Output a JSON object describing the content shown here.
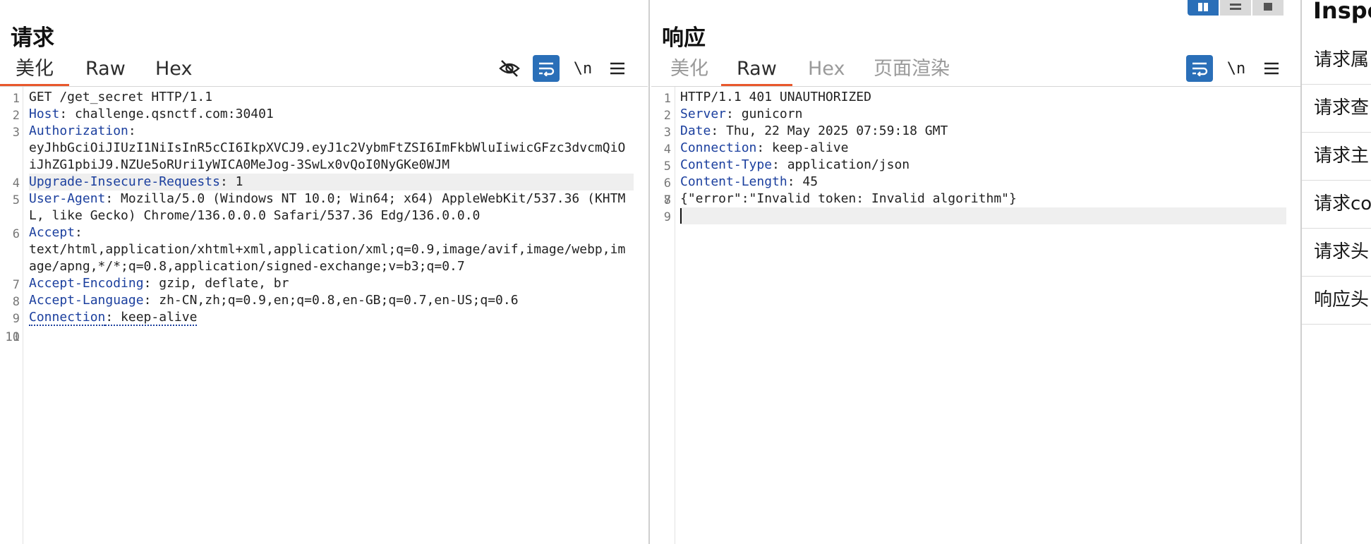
{
  "request": {
    "title": "请求",
    "tabs": [
      "美化",
      "Raw",
      "Hex"
    ],
    "active_tab": 0,
    "toolbar": {
      "newline_label": "\\n"
    },
    "lines": [
      {
        "n": "1",
        "key": "",
        "val": "GET /get_secret HTTP/1.1"
      },
      {
        "n": "2",
        "key": "Host",
        "val": ": challenge.qsnctf.com:30401"
      },
      {
        "n": "3",
        "key": "Authorization",
        "val": ":"
      },
      {
        "n": "",
        "key": "",
        "val": "eyJhbGciOiJIUzI1NiIsInR5cCI6IkpXVCJ9.eyJ1c2VybmFtZSI6ImFkbWluIiwicGFzc3dvcmQiOiJhZG1pbiJ9.NZUe5oRUri1yWICA0MeJog-3SwLx0vQoI0NyGKe0WJM"
      },
      {
        "n": "4",
        "key": "Upgrade-Insecure-Requests",
        "val": ": 1"
      },
      {
        "n": "5",
        "key": "User-Agent",
        "val": ": Mozilla/5.0 (Windows NT 10.0; Win64; x64) AppleWebKit/537.36 (KHTML, like Gecko) Chrome/136.0.0.0 Safari/537.36 Edg/136.0.0.0"
      },
      {
        "n": "6",
        "key": "Accept",
        "val": ":"
      },
      {
        "n": "",
        "key": "",
        "val": "text/html,application/xhtml+xml,application/xml;q=0.9,image/avif,image/webp,image/apng,*/*;q=0.8,application/signed-exchange;v=b3;q=0.7"
      },
      {
        "n": "7",
        "key": "Accept-Encoding",
        "val": ": gzip, deflate, br"
      },
      {
        "n": "8",
        "key": "Accept-Language",
        "val": ": zh-CN,zh;q=0.9,en;q=0.8,en-GB;q=0.7,en-US;q=0.6"
      },
      {
        "n": "9",
        "key": "Connection",
        "val": ": keep-alive"
      },
      {
        "n": "10",
        "key": "",
        "val": ""
      },
      {
        "n": "11",
        "key": "",
        "val": ""
      }
    ]
  },
  "response": {
    "title": "响应",
    "tabs": [
      "美化",
      "Raw",
      "Hex",
      "页面渲染"
    ],
    "active_tab": 1,
    "toolbar": {
      "newline_label": "\\n"
    },
    "lines": [
      {
        "n": "1",
        "key": "",
        "val": "HTTP/1.1 401 UNAUTHORIZED"
      },
      {
        "n": "2",
        "key": "Server",
        "val": ": gunicorn"
      },
      {
        "n": "3",
        "key": "Date",
        "val": ": Thu, 22 May 2025 07:59:18 GMT"
      },
      {
        "n": "4",
        "key": "Connection",
        "val": ": keep-alive"
      },
      {
        "n": "5",
        "key": "Content-Type",
        "val": ": application/json"
      },
      {
        "n": "6",
        "key": "Content-Length",
        "val": ": 45"
      },
      {
        "n": "7",
        "key": "",
        "val": ""
      },
      {
        "n": "8",
        "key": "",
        "val": "{\"error\":\"Invalid token: Invalid algorithm\"}"
      },
      {
        "n": "9",
        "key": "",
        "val": ""
      }
    ]
  },
  "inspector": {
    "title": "Inspe",
    "items": [
      "请求属",
      "请求查",
      "请求主",
      "请求co",
      "请求头",
      "响应头"
    ]
  },
  "colors": {
    "accent": "#2a6fb8",
    "tab_underline": "#e8582c",
    "header_key": "#1b3f9e"
  }
}
